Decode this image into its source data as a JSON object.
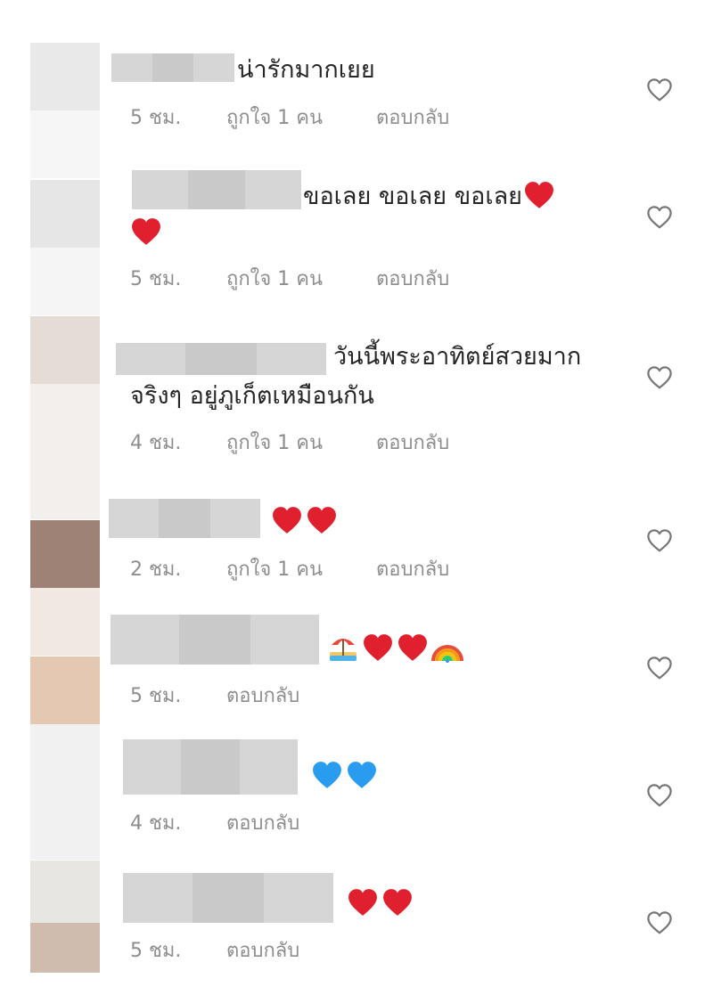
{
  "comments": [
    {
      "text": "น่ารักมากเยย",
      "time": "5 ชม.",
      "likes": "ถูกใจ 1 คน",
      "reply": "ตอบกลับ",
      "avatar_colors": [
        "#e9e9e9",
        "#f6f6f6"
      ]
    },
    {
      "text": "ขอเลย ขอเลย ขอเลย",
      "time": "5 ชม.",
      "likes": "ถูกใจ 1 คน",
      "reply": "ตอบกลับ",
      "avatar_colors": [
        "#e6e6e6",
        "#f5f5f5"
      ]
    },
    {
      "text_line1": "วันนี้พระอาทิตย์สวยมาก",
      "text_line2": "จริงๆ อยู่ภูเก็ตเหมือนกัน",
      "time": "4 ชม.",
      "likes": "ถูกใจ 1 คน",
      "reply": "ตอบกลับ",
      "avatar_colors": [
        "#e5dcd6",
        "#f3efec"
      ]
    },
    {
      "time": "2 ชม.",
      "likes": "ถูกใจ 1 คน",
      "reply": "ตอบกลับ",
      "avatar_colors": [
        "#9e8276",
        "#f2e8e2"
      ]
    },
    {
      "time": "5 ชม.",
      "reply": "ตอบกลับ",
      "avatar_colors": [
        "#f0e2da",
        "#e4c8b1"
      ]
    },
    {
      "time": "4 ชม.",
      "reply": "ตอบกลับ",
      "avatar_colors": [
        "#f1f1f1",
        "#f5f5f5"
      ]
    },
    {
      "time": "5 ชม.",
      "reply": "ตอบกลับ",
      "avatar_colors": [
        "#e8e6e3",
        "#cfbcae"
      ]
    }
  ],
  "colors": {
    "red_heart": "#e0202e",
    "blue_heart": "#2a9cf0",
    "meta_text": "#8e8e8e",
    "like_icon": "#777777"
  },
  "icons": {
    "like": "heart-outline-icon",
    "emoji_red": "red-heart-emoji",
    "emoji_blue": "blue-heart-emoji",
    "emoji_beach": "beach-umbrella-emoji",
    "emoji_rainbow": "rainbow-emoji"
  }
}
